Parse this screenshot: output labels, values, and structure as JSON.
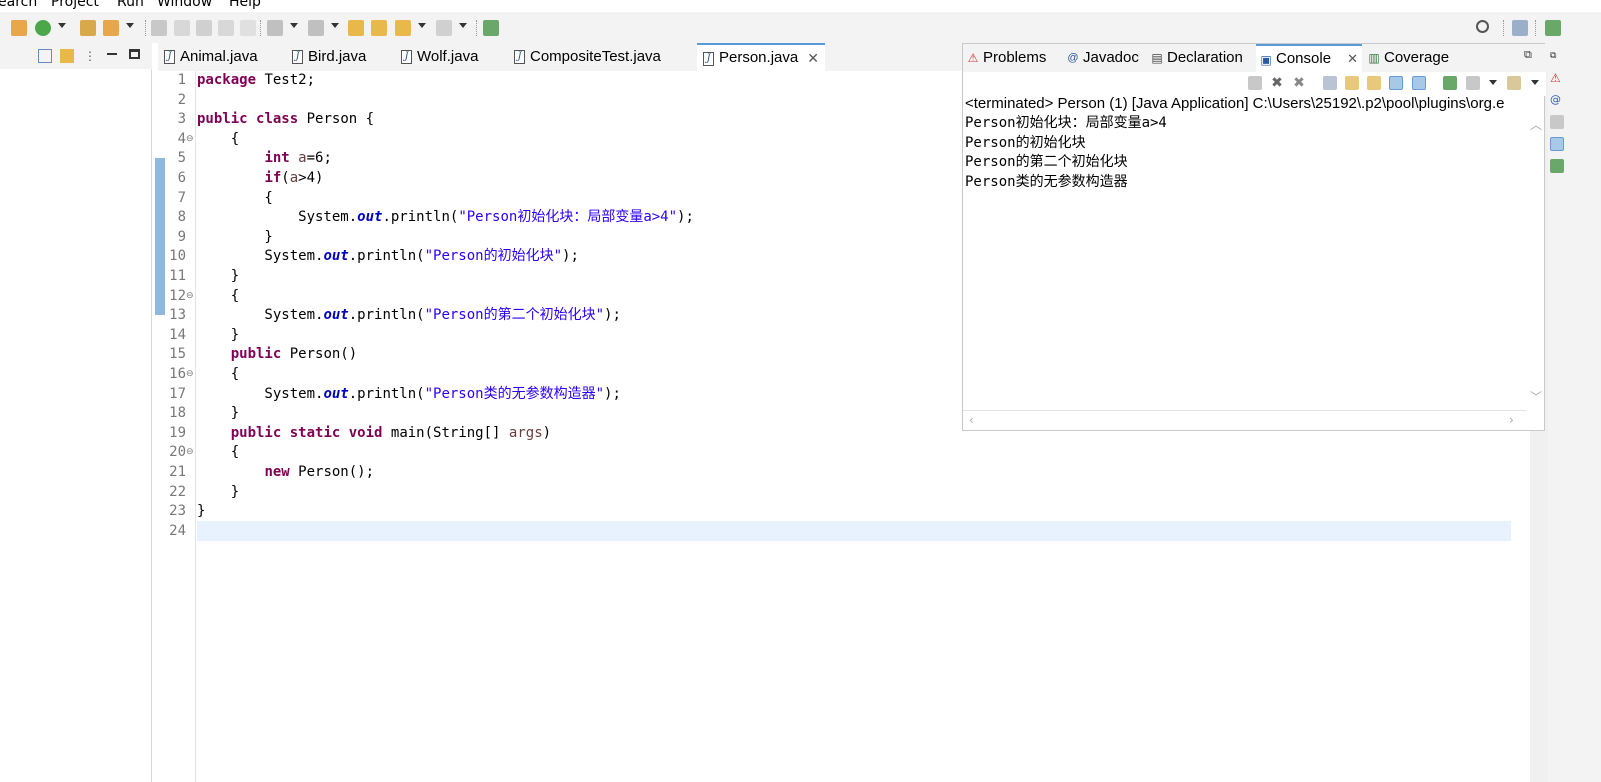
{
  "menubar": {
    "items": [
      "earch",
      "Project",
      "Run",
      "Window",
      "Help"
    ]
  },
  "editor": {
    "tabs": [
      {
        "label": "Animal.java",
        "active": false
      },
      {
        "label": "Bird.java",
        "active": false
      },
      {
        "label": "Wolf.java",
        "active": false
      },
      {
        "label": "CompositeTest.java",
        "active": false
      },
      {
        "label": "Person.java",
        "active": true
      }
    ],
    "close_glyph": "✕",
    "line_numbers": [
      "1",
      "2",
      "3",
      "4",
      "5",
      "6",
      "7",
      "8",
      "9",
      "10",
      "11",
      "12",
      "13",
      "14",
      "15",
      "16",
      "17",
      "18",
      "19",
      "20",
      "21",
      "22",
      "23",
      "24"
    ],
    "current_line": 24,
    "code": {
      "l1_kw": "package",
      "l1_rest": " Test2;",
      "l3_kw1": "public",
      "l3_kw2": "class",
      "l3_rest": " Person {",
      "l4": "    {",
      "l5_kw": "int",
      "l5_var": "a",
      "l5_rest": "=6;",
      "l6_kw": "if",
      "l6_open": "(",
      "l6_var": "a",
      "l6_rest": ">4)",
      "l7": "        {",
      "l8_pre": "            System.",
      "l8_fld": "out",
      "l8_mid": ".println(",
      "l8_str": "\"Person初始化块：局部变量a>4\"",
      "l8_end": ");",
      "l9": "        }",
      "l10_pre": "        System.",
      "l10_fld": "out",
      "l10_mid": ".println(",
      "l10_str": "\"Person的初始化块\"",
      "l10_end": ");",
      "l11": "    }",
      "l12": "    {",
      "l13_pre": "        System.",
      "l13_fld": "out",
      "l13_mid": ".println(",
      "l13_str": "\"Person的第二个初始化块\"",
      "l13_end": ");",
      "l14": "    }",
      "l15_kw": "public",
      "l15_rest": " Person()",
      "l16": "    {",
      "l17_pre": "        System.",
      "l17_fld": "out",
      "l17_mid": ".println(",
      "l17_str": "\"Person类的无参数构造器\"",
      "l17_end": ");",
      "l18": "    }",
      "l19_kw1": "public",
      "l19_kw2": "static",
      "l19_kw3": "void",
      "l19_mid": " main(String[] ",
      "l19_var": "args",
      "l19_end": ")",
      "l20": "    {",
      "l21_kw": "new",
      "l21_rest": " Person();",
      "l22": "    }",
      "l23": "}"
    }
  },
  "console": {
    "tabs": [
      {
        "label": "Problems",
        "icon": "problems-icon"
      },
      {
        "label": "Javadoc",
        "icon": "javadoc-icon"
      },
      {
        "label": "Declaration",
        "icon": "declaration-icon"
      },
      {
        "label": "Console",
        "icon": "console-icon",
        "active": true
      },
      {
        "label": "Coverage",
        "icon": "coverage-icon"
      }
    ],
    "close_glyph": "✕",
    "status": "<terminated> Person (1) [Java Application] C:\\Users\\25192\\.p2\\pool\\plugins\\org.e",
    "output": [
      "Person初始化块：局部变量a>4",
      "Person的初始化块",
      "Person的第二个初始化块",
      "Person类的无参数构造器"
    ]
  },
  "colors": {
    "keyword": "#7f0055",
    "string": "#2a00ff",
    "field": "#0000c0",
    "variable": "#6a3e3e",
    "line_number": "#787878",
    "current_line_bg": "#e8f2fe",
    "change_bar": "#8fb8e0",
    "active_tab_border": "#5a9ad6"
  }
}
